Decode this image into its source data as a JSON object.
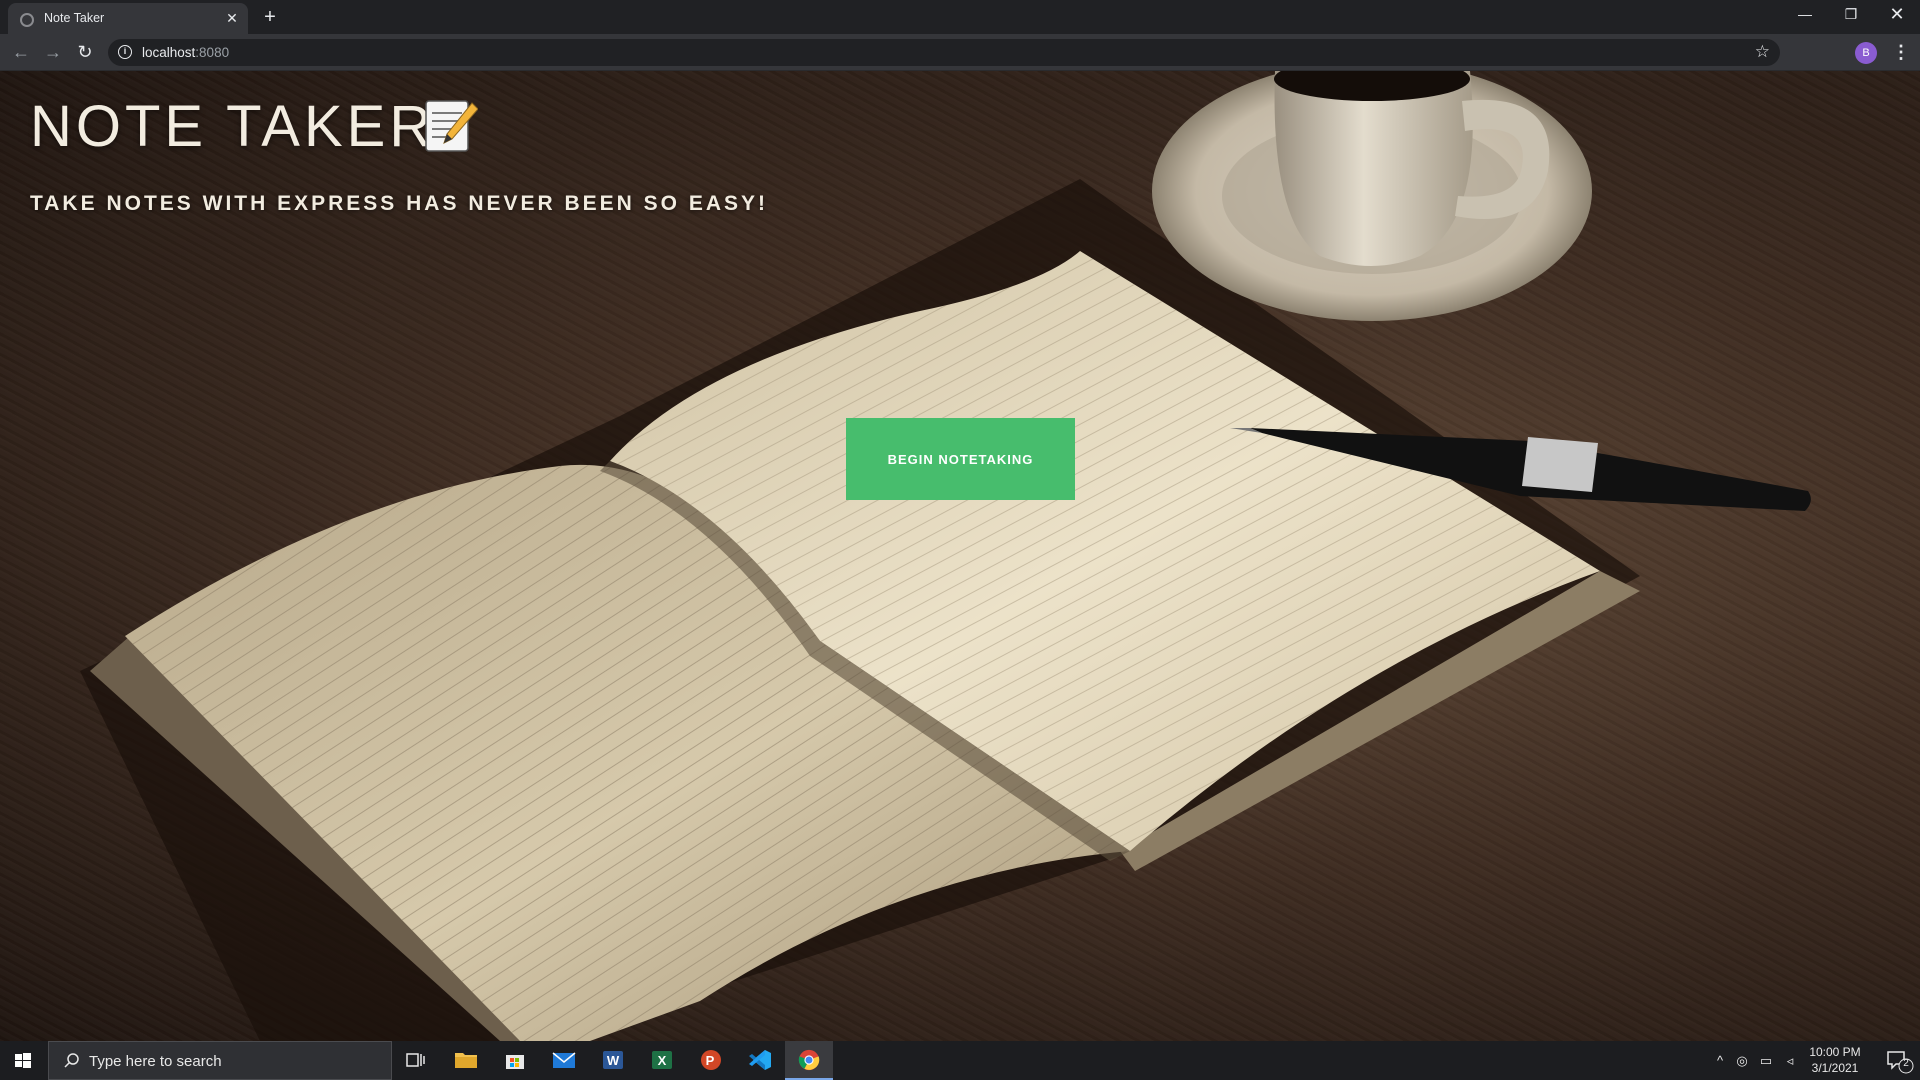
{
  "browser": {
    "tab_title": "Note Taker",
    "new_tab_label": "+",
    "close_tab_label": "✕",
    "url_host": "localhost",
    "url_port": ":8080",
    "profile_initial": "B",
    "window_controls": {
      "minimize": "—",
      "maximize": "❐",
      "close": "✕"
    }
  },
  "page": {
    "title": "NOTE TAKER",
    "title_icon": "memo-icon",
    "subtitle": "TAKE NOTES WITH EXPRESS HAS NEVER BEEN SO EASY!",
    "cta_label": "BEGIN NOTETAKING",
    "accent_color": "#47bd6d",
    "background": "photo of open notebook, pen and coffee cup on wooden desk"
  },
  "taskbar": {
    "search_placeholder": "Type here to search",
    "apps": [
      "task-view-icon",
      "file-explorer-icon",
      "store-icon",
      "mail-icon",
      "word-icon",
      "excel-icon",
      "powerpoint-icon",
      "vscode-icon",
      "chrome-icon"
    ],
    "active_app": "chrome-icon",
    "time": "10:00 PM",
    "date": "3/1/2021",
    "notification_count": "2"
  }
}
